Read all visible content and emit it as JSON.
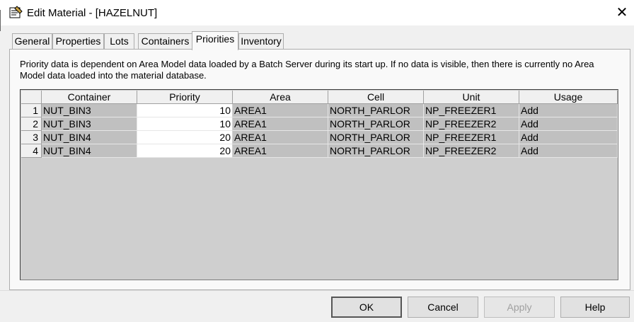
{
  "window": {
    "title": "Edit Material - [HAZELNUT]",
    "close_glyph": "✕",
    "icon": "material-dialog-icon"
  },
  "tabs": [
    {
      "label": "General"
    },
    {
      "label": "Properties"
    },
    {
      "label": "Lots"
    },
    {
      "label": "Containers"
    },
    {
      "label": "Priorities",
      "active": true
    },
    {
      "label": "Inventory"
    }
  ],
  "info_text": "Priority data is dependent on Area Model data loaded by a Batch Server during its start up. If no data is visible, then there is currently no Area Model data loaded into the material database.",
  "grid": {
    "columns": [
      "Container",
      "Priority",
      "Area",
      "Cell",
      "Unit",
      "Usage"
    ],
    "rows": [
      {
        "num": "1",
        "cells": [
          "NUT_BIN3",
          "10",
          "AREA1",
          "NORTH_PARLOR",
          "NP_FREEZER1",
          "Add"
        ]
      },
      {
        "num": "2",
        "cells": [
          "NUT_BIN3",
          "10",
          "AREA1",
          "NORTH_PARLOR",
          "NP_FREEZER2",
          "Add"
        ]
      },
      {
        "num": "3",
        "cells": [
          "NUT_BIN4",
          "20",
          "AREA1",
          "NORTH_PARLOR",
          "NP_FREEZER1",
          "Add"
        ]
      },
      {
        "num": "4",
        "cells": [
          "NUT_BIN4",
          "20",
          "AREA1",
          "NORTH_PARLOR",
          "NP_FREEZER2",
          "Add"
        ]
      }
    ]
  },
  "buttons": {
    "ok": "OK",
    "cancel": "Cancel",
    "apply": "Apply",
    "help": "Help"
  },
  "colors": {
    "grid_data_bg": "#c0c0c0",
    "editable_bg": "#ffffff",
    "disabled_text": "#a0a0a0"
  }
}
